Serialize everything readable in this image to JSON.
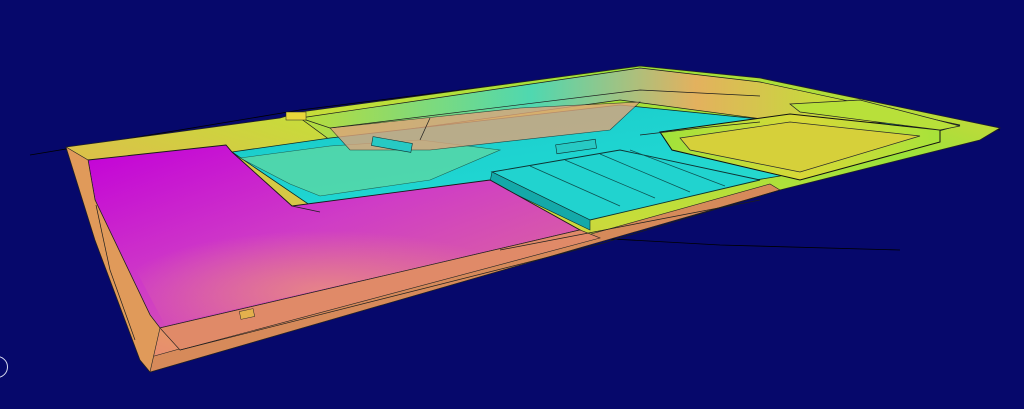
{
  "viewport": {
    "background_color": "#06086b",
    "color_scale": [
      "#d000d8",
      "#e07a86",
      "#e9d33a",
      "#a9e62c",
      "#19d7d4"
    ]
  },
  "controls": {
    "navigation_icon": "orbit-circle-icon"
  }
}
